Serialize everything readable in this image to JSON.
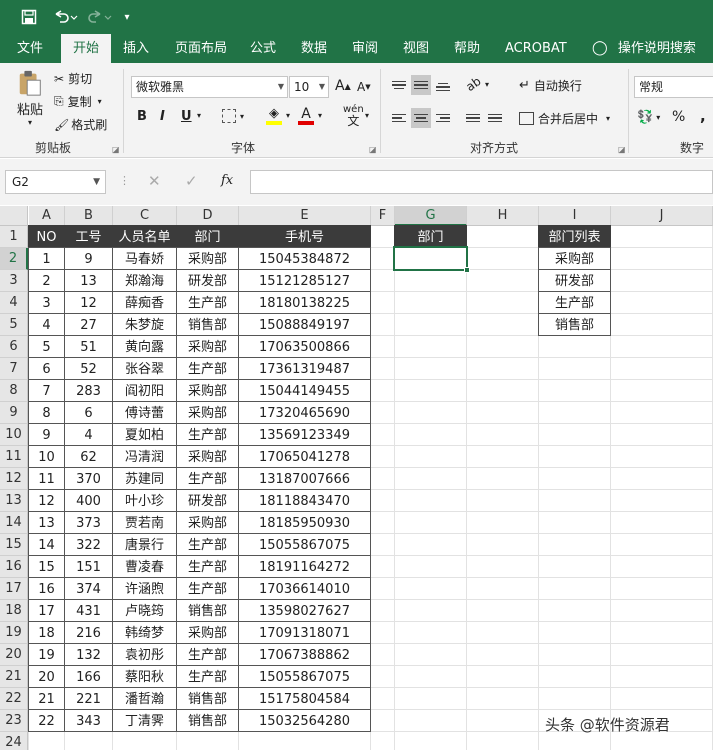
{
  "qat": {
    "save_icon": "save-icon",
    "undo_icon": "undo-icon",
    "redo_icon": "redo-icon",
    "customize_icon": "customize-qat-icon"
  },
  "tabs": [
    "文件",
    "开始",
    "插入",
    "页面布局",
    "公式",
    "数据",
    "审阅",
    "视图",
    "帮助",
    "ACROBAT",
    "操作说明搜索"
  ],
  "active_tab": "开始",
  "ribbon": {
    "clipboard": {
      "paste": "粘贴",
      "cut": "剪切",
      "copy": "复制",
      "format_painter": "格式刷",
      "label": "剪贴板"
    },
    "font": {
      "name": "微软雅黑",
      "size": "10",
      "grow": "A",
      "shrink": "A",
      "bold": "B",
      "italic": "I",
      "underline": "U",
      "font_color_letter": "A",
      "phonetic": "wén",
      "label": "字体"
    },
    "alignment": {
      "wrap": "自动换行",
      "merge": "合并后居中",
      "label": "对齐方式"
    },
    "number": {
      "format": "常规",
      "percent": "%",
      "comma": ",",
      "label": "数字"
    }
  },
  "formula_bar": {
    "name_box": "G2",
    "fx": "fx",
    "formula": ""
  },
  "columns": [
    "A",
    "B",
    "C",
    "D",
    "E",
    "F",
    "G",
    "H",
    "I",
    "J"
  ],
  "rows": [
    "1",
    "2",
    "3",
    "4",
    "5",
    "6",
    "7",
    "8",
    "9",
    "10",
    "11",
    "12",
    "13",
    "14",
    "15",
    "16",
    "17",
    "18",
    "19",
    "20",
    "21",
    "22",
    "23",
    "24"
  ],
  "active_cell": "G2",
  "table": {
    "headers": [
      "NO",
      "工号",
      "人员名单",
      "部门",
      "手机号"
    ],
    "rows": [
      [
        "1",
        "9",
        "马春娇",
        "采购部",
        "15045384872"
      ],
      [
        "2",
        "13",
        "郑瀚海",
        "研发部",
        "15121285127"
      ],
      [
        "3",
        "12",
        "薛痴香",
        "生产部",
        "18180138225"
      ],
      [
        "4",
        "27",
        "朱梦旋",
        "销售部",
        "15088849197"
      ],
      [
        "5",
        "51",
        "黄向露",
        "采购部",
        "17063500866"
      ],
      [
        "6",
        "52",
        "张谷翠",
        "生产部",
        "17361319487"
      ],
      [
        "7",
        "283",
        "阎初阳",
        "采购部",
        "15044149455"
      ],
      [
        "8",
        "6",
        "傅诗蕾",
        "采购部",
        "17320465690"
      ],
      [
        "9",
        "4",
        "夏如柏",
        "生产部",
        "13569123349"
      ],
      [
        "10",
        "62",
        "冯清润",
        "采购部",
        "17065041278"
      ],
      [
        "11",
        "370",
        "苏建同",
        "生产部",
        "13187007666"
      ],
      [
        "12",
        "400",
        "叶小珍",
        "研发部",
        "18118843470"
      ],
      [
        "13",
        "373",
        "贾若南",
        "采购部",
        "18185950930"
      ],
      [
        "14",
        "322",
        "唐景行",
        "生产部",
        "15055867075"
      ],
      [
        "15",
        "151",
        "曹凌春",
        "生产部",
        "18191164272"
      ],
      [
        "16",
        "374",
        "许涵煦",
        "生产部",
        "17036614010"
      ],
      [
        "17",
        "431",
        "卢晓筠",
        "销售部",
        "13598027627"
      ],
      [
        "18",
        "216",
        "韩绮梦",
        "采购部",
        "17091318071"
      ],
      [
        "19",
        "132",
        "袁初彤",
        "生产部",
        "17067388862"
      ],
      [
        "20",
        "166",
        "蔡阳秋",
        "生产部",
        "15055867075"
      ],
      [
        "21",
        "221",
        "潘哲瀚",
        "销售部",
        "15175804584"
      ],
      [
        "22",
        "343",
        "丁清霁",
        "销售部",
        "15032564280"
      ]
    ]
  },
  "dept_input": {
    "header": "部门",
    "value": ""
  },
  "dept_list": {
    "header": "部门列表",
    "items": [
      "采购部",
      "研发部",
      "生产部",
      "销售部"
    ]
  },
  "watermark": "头条 @软件资源君",
  "colors": {
    "excel_green": "#217346",
    "header_fill": "#3b3b3b"
  }
}
